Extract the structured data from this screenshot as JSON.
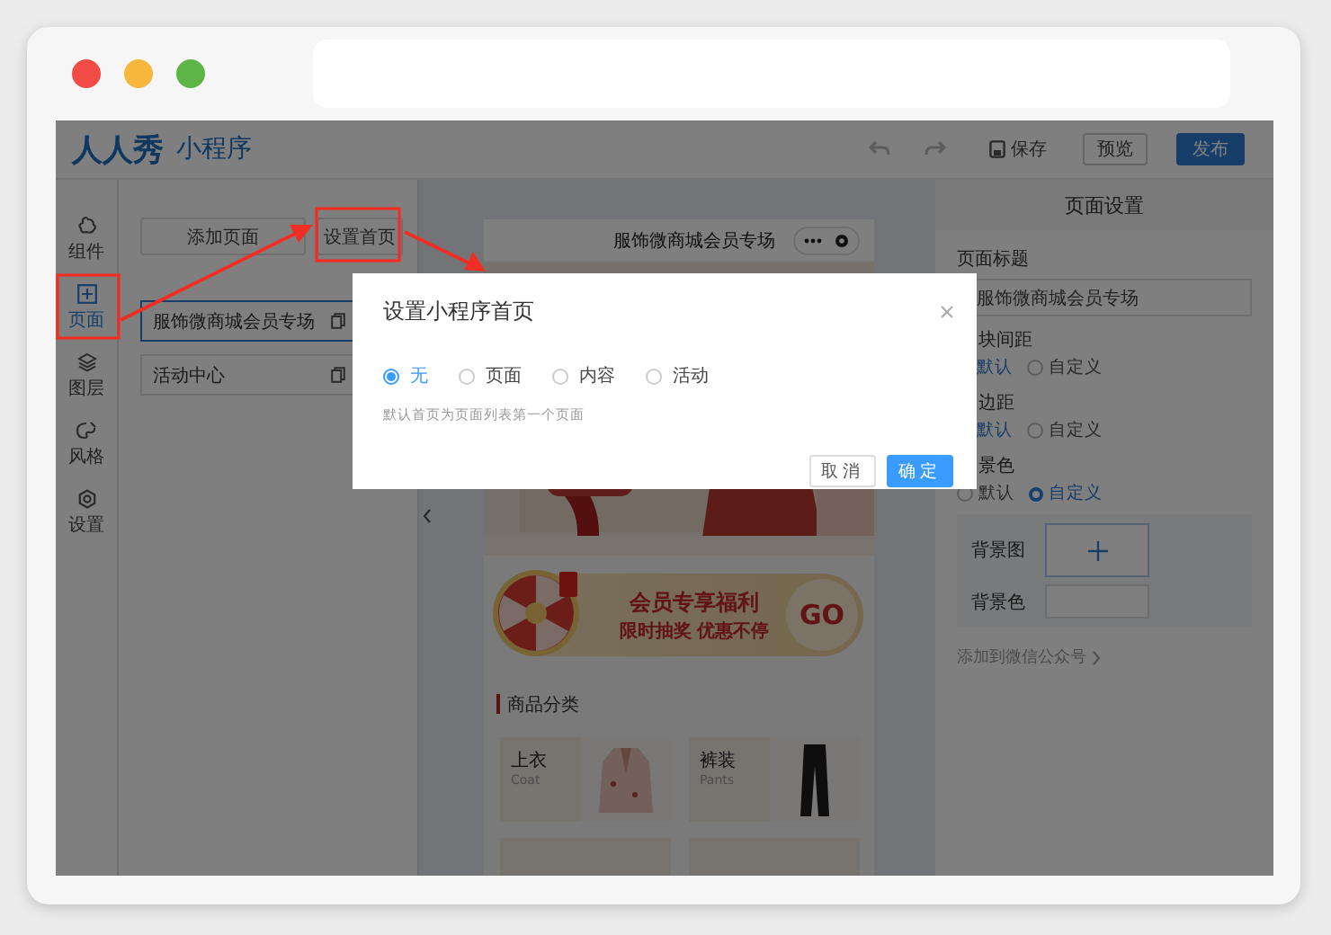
{
  "app": {
    "logo": "人人秀",
    "product": "小程序"
  },
  "toolbar": {
    "save": "保存",
    "buttons": [
      {
        "label": "预览",
        "kind": "plain"
      },
      {
        "label": "发布",
        "kind": "primary"
      }
    ]
  },
  "rail": [
    {
      "label": "组件",
      "selected": false
    },
    {
      "label": "页面",
      "selected": true
    },
    {
      "label": "图层",
      "selected": false
    },
    {
      "label": "风格",
      "selected": false
    },
    {
      "label": "设置",
      "selected": false
    }
  ],
  "page_list": {
    "buttons": [
      "添加页面",
      "设置首页"
    ],
    "pages": [
      {
        "title": "服饰微商城会员专场",
        "selected": true
      },
      {
        "title": "活动中心",
        "selected": false
      }
    ]
  },
  "preview": {
    "title": "服饰微商城会员专场",
    "promo": {
      "headline": "会员专享福利",
      "subline": "限时抽奖 优惠不停",
      "action": "GO"
    },
    "section_title": "商品分类",
    "categories": [
      {
        "kind": "top",
        "name": "上衣",
        "english": "Coat"
      },
      {
        "kind": "pants",
        "name": "裤装",
        "english": "Pants"
      },
      {
        "kind": "cut"
      },
      {
        "kind": "cut"
      }
    ]
  },
  "settings": {
    "title": "页面设置",
    "page_title_label": "页面标题",
    "page_title_value": "服饰微商城会员专场",
    "groups": [
      {
        "label": "块间距",
        "options": [
          {
            "label": "默认",
            "selected": true
          },
          {
            "label": "自定义",
            "selected": false
          }
        ]
      },
      {
        "label": "边距",
        "options": [
          {
            "label": "默认",
            "selected": true
          },
          {
            "label": "自定义",
            "selected": false
          }
        ]
      },
      {
        "label": "景色",
        "options": [
          {
            "label": "默认",
            "selected": false
          },
          {
            "label": "自定义",
            "selected": true
          }
        ]
      }
    ],
    "background_image_label": "背景图",
    "background_color_label": "背景色",
    "link": "添加到微信公众号"
  },
  "dialog": {
    "title": "设置小程序首页",
    "options": [
      {
        "label": "无",
        "selected": true
      },
      {
        "label": "页面",
        "selected": false
      },
      {
        "label": "内容",
        "selected": false
      },
      {
        "label": "活动",
        "selected": false
      }
    ],
    "hint": "默认首页为页面列表第一个页面",
    "buttons": [
      {
        "label": "取消",
        "kind": "plain"
      },
      {
        "label": "确定",
        "kind": "primary"
      }
    ]
  }
}
